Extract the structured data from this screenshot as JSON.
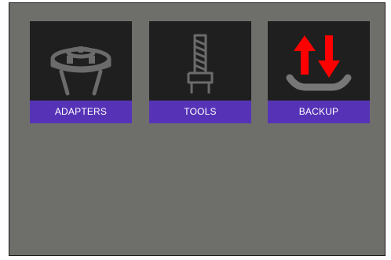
{
  "tiles": [
    {
      "label": "ADAPTERS",
      "icon": "adapter-icon"
    },
    {
      "label": "TOOLS",
      "icon": "tool-icon"
    },
    {
      "label": "BACKUP",
      "icon": "backup-icon"
    }
  ],
  "colors": {
    "background": "#6e6f6b",
    "tile": "#1f1f1f",
    "label_bar": "#5633b6",
    "icon_stroke": "#6b6b6b",
    "backup_arrows": "#ff0000",
    "backup_tray": "#777777"
  }
}
